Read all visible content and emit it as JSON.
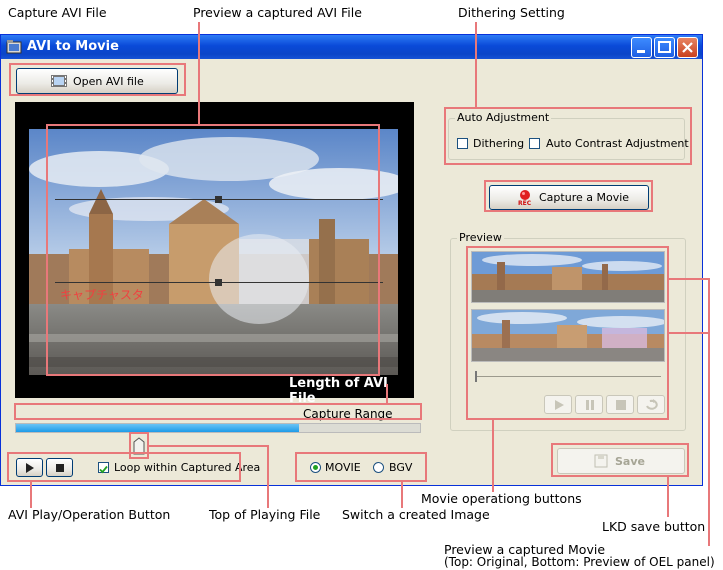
{
  "annotations": {
    "capture_avi_file": "Capture AVI File",
    "preview_captured_avi": "Preview a captured AVI File",
    "dithering_setting": "Dithering Setting",
    "avi_play_operation": "AVI Play/Operation Button",
    "top_of_playing_file": "Top of  Playing File",
    "switch_created_image": "Switch a created Image",
    "movie_operation_buttons": "Movie operationg buttons",
    "lkd_save_button": "LKD save button",
    "preview_captured_movie_line1": "Preview a captured Movie",
    "preview_captured_movie_line2": "(Top: Original, Bottom: Preview of OEL panel)"
  },
  "window": {
    "title": "AVI to Movie"
  },
  "toolbar": {
    "open_avi_label": "Open AVI file"
  },
  "video": {
    "overlay_text": "キャプチャスタ",
    "length_label": "Length of AVI File",
    "capture_range_label": "Capture Range",
    "progress_fraction": 0.7
  },
  "auto_adjustment": {
    "group_label": "Auto Adjustment",
    "dithering_label": "Dithering",
    "dithering_checked": false,
    "auto_contrast_label": "Auto Contrast Adjustment",
    "auto_contrast_checked": false
  },
  "capture_button": {
    "label": "Capture a Movie",
    "rec_badge": "REC"
  },
  "preview": {
    "group_label": "Preview"
  },
  "playback": {
    "loop_label": "Loop within Captured Area",
    "loop_checked": true
  },
  "output_type": {
    "movie_label": "MOVIE",
    "bgv_label": "BGV",
    "selected": "MOVIE"
  },
  "save": {
    "label": "Save"
  },
  "colors": {
    "annotation_box": "#e8787a",
    "progress_fill": "#1e9be8",
    "title_bar": "#0a4ad8"
  }
}
